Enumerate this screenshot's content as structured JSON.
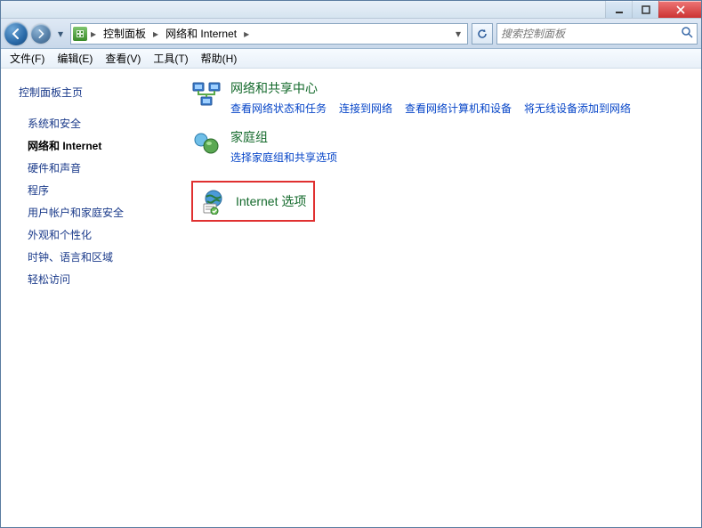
{
  "window": {
    "min_tip": "Minimize",
    "max_tip": "Maximize",
    "close_tip": "Close"
  },
  "breadcrumb": {
    "root": "控制面板",
    "current": "网络和 Internet"
  },
  "search": {
    "placeholder": "搜索控制面板"
  },
  "menu": {
    "file": "文件(F)",
    "edit": "编辑(E)",
    "view": "查看(V)",
    "tools": "工具(T)",
    "help": "帮助(H)"
  },
  "sidebar": {
    "home": "控制面板主页",
    "items": [
      "系统和安全",
      "网络和 Internet",
      "硬件和声音",
      "程序",
      "用户帐户和家庭安全",
      "外观和个性化",
      "时钟、语言和区域",
      "轻松访问"
    ]
  },
  "categories": {
    "net_share": {
      "title": "网络和共享中心",
      "links": [
        "查看网络状态和任务",
        "连接到网络",
        "查看网络计算机和设备",
        "将无线设备添加到网络"
      ]
    },
    "homegroup": {
      "title": "家庭组",
      "links": [
        "选择家庭组和共享选项"
      ]
    },
    "internet": {
      "title": "Internet 选项"
    }
  }
}
